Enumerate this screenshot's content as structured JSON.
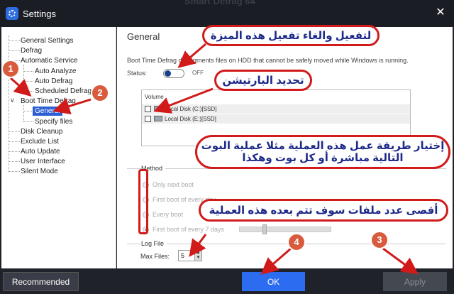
{
  "window": {
    "title": "Settings",
    "close_glyph": "✕",
    "background_hint": "Smart Defrag 64"
  },
  "tree": {
    "items": [
      {
        "label": "General Settings"
      },
      {
        "label": "Defrag"
      },
      {
        "label": "Automatic Service"
      },
      {
        "label": "Auto Analyze"
      },
      {
        "label": "Auto Defrag"
      },
      {
        "label": "Scheduled Defrag"
      },
      {
        "label": "Boot Time Defrag"
      },
      {
        "label": "General"
      },
      {
        "label": "Specify files"
      },
      {
        "label": "Disk Cleanup"
      },
      {
        "label": "Exclude List"
      },
      {
        "label": "Auto Update"
      },
      {
        "label": "User Interface"
      },
      {
        "label": "Silent Mode"
      }
    ],
    "expander_glyph": "∨"
  },
  "content": {
    "section_title": "General",
    "description": "Boot Time Defrag defragments files on HDD that cannot be safely moved while Windows is running.",
    "status_label": "Status:",
    "status_value": "OFF",
    "volume_header": "Volume",
    "volumes": [
      {
        "label": "Local Disk (C:)[SSD]"
      },
      {
        "label": "Local Disk (E:)[SSD]"
      }
    ],
    "method_label": "Method",
    "methods": [
      {
        "label": "Only next boot"
      },
      {
        "label": "First boot of every day"
      },
      {
        "label": "Every boot"
      },
      {
        "label": "First boot of every 7 days"
      }
    ],
    "log_label": "Log File",
    "max_files_label": "Max Files:",
    "max_files_value": "5"
  },
  "buttons": {
    "recommended": "Recommended",
    "ok": "OK",
    "apply": "Apply"
  },
  "annotations": {
    "toggle_note": "لتفعيل والغاء تفعيل هذه الميزة",
    "partition_note": "تحديد البارتيشن",
    "method_note": "إختيار طريقة عمل هذه العملية مثلا عملية البوت التالية مباشرة أو كل بوت وهكذا",
    "maxfiles_note": "أقصى عدد ملفات سوف تتم بعده هذه العملية",
    "numbers": [
      "1",
      "2",
      "3",
      "4"
    ]
  },
  "colors": {
    "accent": "#2c6cf0",
    "annotation_red": "#d11a1a",
    "annotation_text": "#1e2a8a",
    "number_badge": "#d95b3d"
  }
}
